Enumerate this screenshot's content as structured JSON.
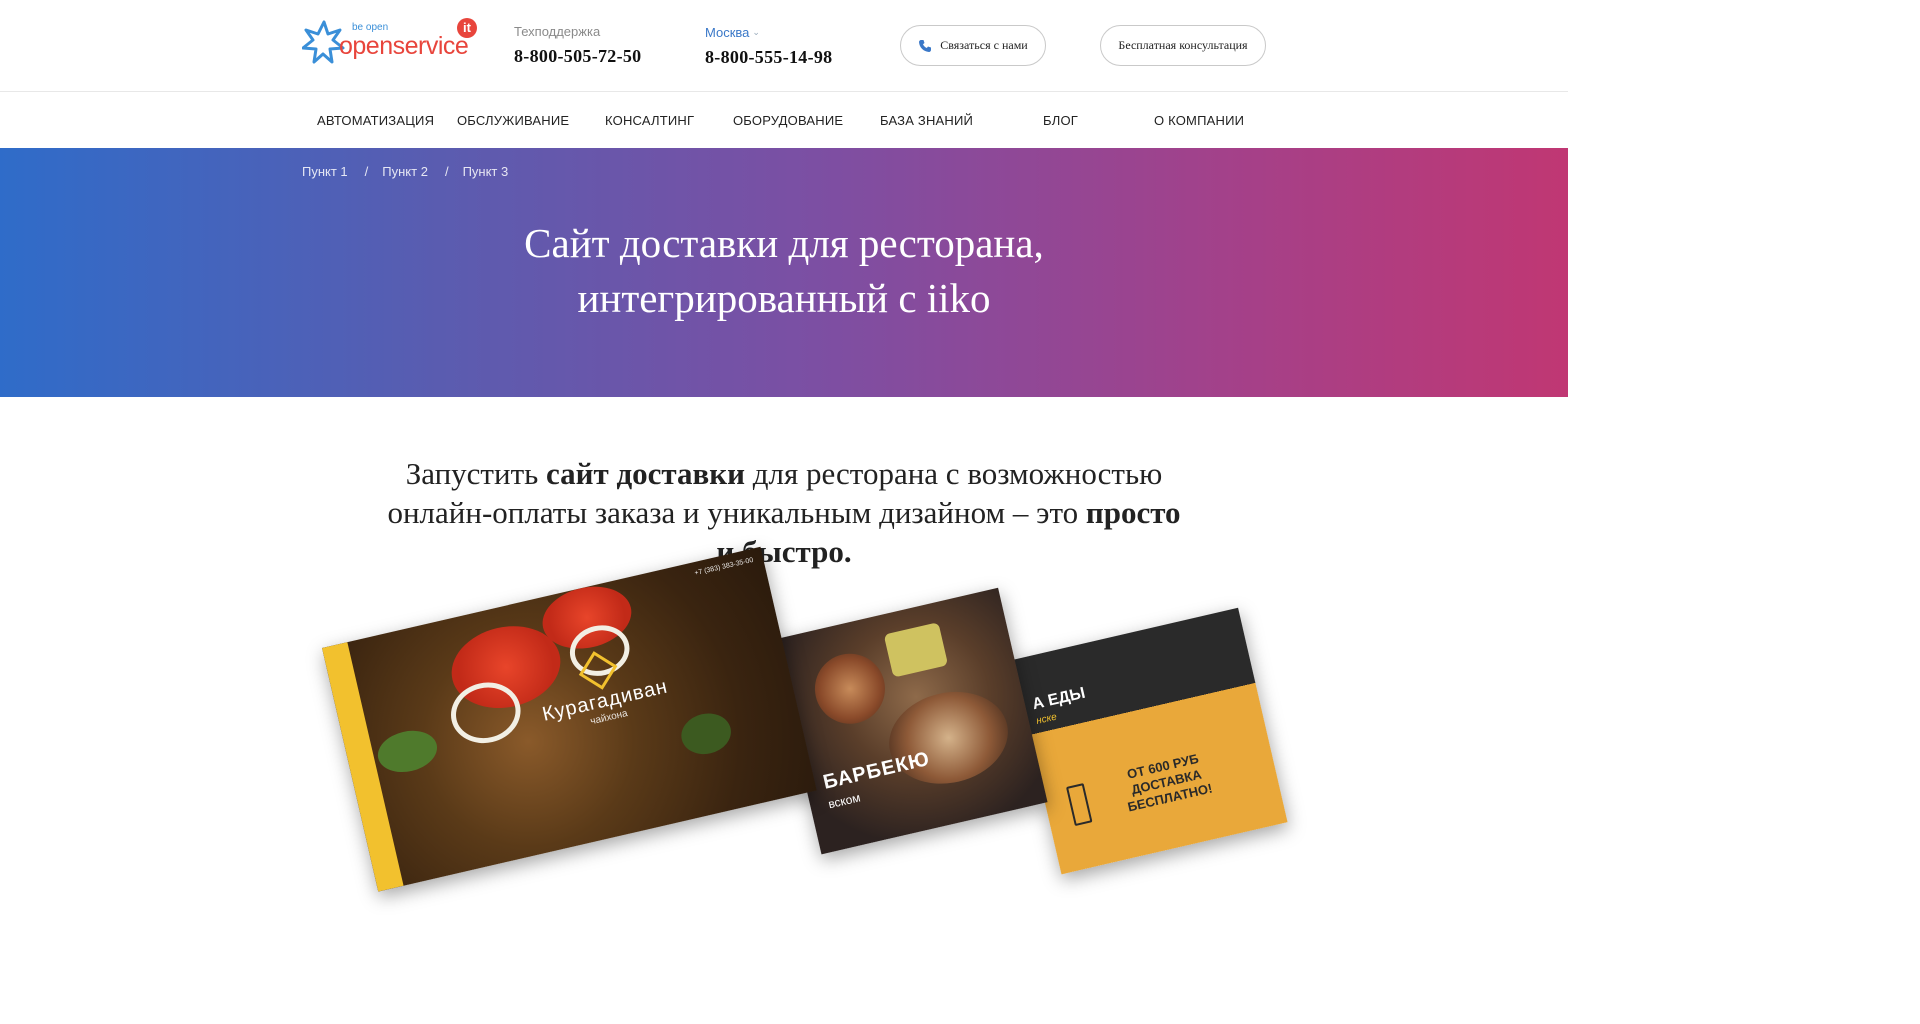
{
  "brand": {
    "tagline": "be open",
    "name": "openservice",
    "badge": "it",
    "colors": {
      "blue": "#3a8fd8",
      "red": "#e8453c"
    }
  },
  "header": {
    "support": {
      "label": "Техподдержка",
      "phone": "8-800-505-72-50"
    },
    "city": {
      "label": "Москва",
      "phone": "8-800-555-14-98"
    },
    "contact_button": "Связаться с нами",
    "consult_button": "Бесплатная консультация"
  },
  "nav": {
    "items": [
      {
        "label": "АВТОМАТИЗАЦИЯ"
      },
      {
        "label": "ОБСЛУЖИВАНИЕ"
      },
      {
        "label": "КОНСАЛТИНГ"
      },
      {
        "label": "ОБОРУДОВАНИЕ"
      },
      {
        "label": "БАЗА ЗНАНИЙ"
      },
      {
        "label": "БЛОГ"
      },
      {
        "label": "О КОМПАНИИ"
      }
    ]
  },
  "hero": {
    "breadcrumbs": [
      "Пункт 1",
      "Пункт 2",
      "Пункт 3"
    ],
    "separator": "/",
    "title_line1": "Сайт доставки для ресторана,",
    "title_line2": "интегрированный с iiko",
    "gradient": {
      "from": "#2f6cc9",
      "to": "#c03773"
    }
  },
  "intro": {
    "p1": "Запустить ",
    "b1": "сайт доставки",
    "p2": " для ресторана с возможностью онлайн-оплаты заказа и уникальным дизайном – это ",
    "b2": "просто и быстро."
  },
  "mockups": {
    "m1": {
      "name": "Курагадиван",
      "sub": "чайхона",
      "phone": "+7 (383) 383-35-00"
    },
    "m2": {
      "title": "БАРБЕКЮ",
      "sub": "вском"
    },
    "m3": {
      "head": "А ЕДЫ",
      "sub": "нске",
      "promo": "ОТ 600 РУБ ДОСТАВКА БЕСПЛАТНО!"
    }
  }
}
